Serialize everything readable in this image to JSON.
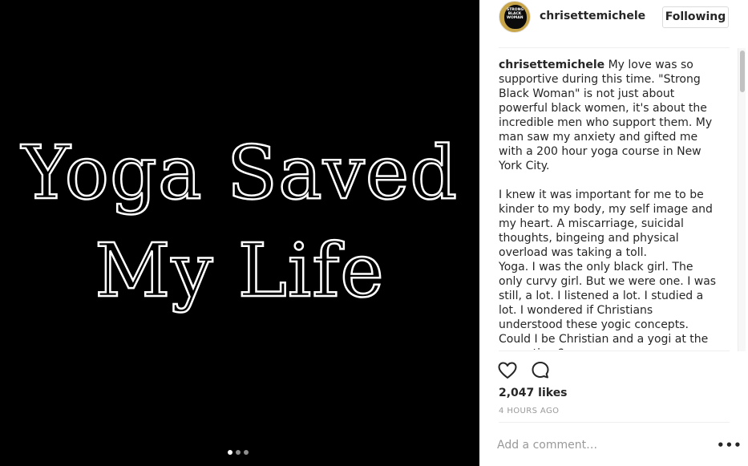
{
  "media": {
    "line1": "Yoga Saved",
    "line2": "My Life",
    "carousel": {
      "count": 3,
      "active": 1
    }
  },
  "header": {
    "avatar_text": "STRONG BLACK WOMAN",
    "username": "chrisettemichele",
    "follow_label": "Following"
  },
  "caption": {
    "username": "chrisettemichele",
    "text": " My love was so supportive during this time. \"Strong Black Woman\" is not just about powerful black women, it's about the incredible men who support them. My man saw my anxiety and gifted me with a 200 hour yoga course in New York City.\n\nI knew it was important for me to be kinder to my body, my self image and my heart. A miscarriage, suicidal thoughts, bingeing and physical overload was taking a toll.\nYoga. I was the only black girl. The only curvy girl. But we were one. I was still, a lot. I listened a lot. I studied a lot. I wondered if Christians understood these yogic concepts. Could I be Christian and a yogi at the same time?"
  },
  "actions": {
    "like_icon": "heart-outline",
    "comment_icon": "speech-bubble-outline"
  },
  "likes": "2,047 likes",
  "time": "4 HOURS AGO",
  "comment": {
    "placeholder": "Add a comment…",
    "more_label": "•••"
  }
}
